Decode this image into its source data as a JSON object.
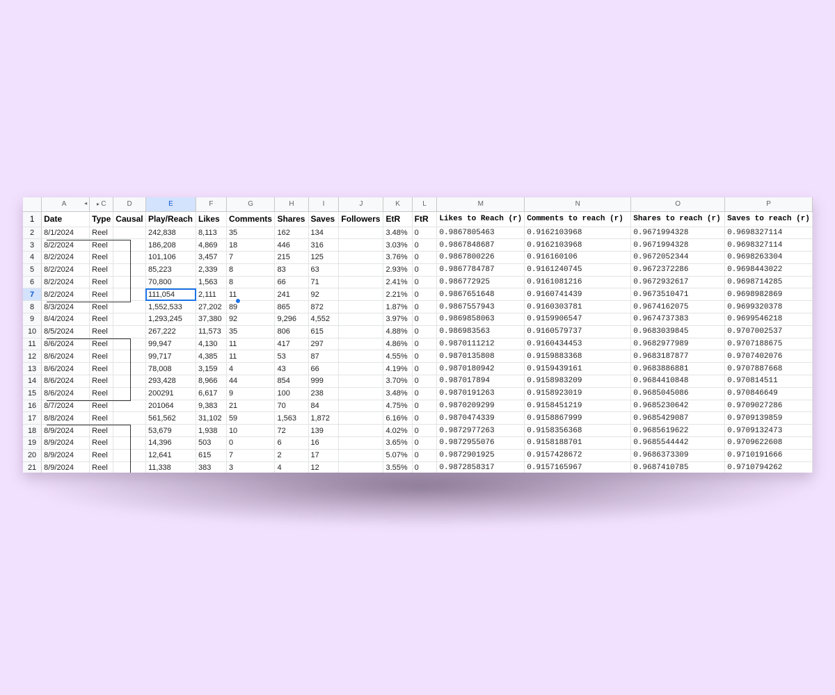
{
  "colors": {
    "background": "#f2e1fe",
    "selection": "#1a73e8",
    "selected_header_bg": "#d3e3fd"
  },
  "column_letters": [
    "A",
    "C",
    "D",
    "E",
    "F",
    "G",
    "H",
    "I",
    "J",
    "K",
    "L",
    "M",
    "N",
    "O",
    "P"
  ],
  "hidden_column_indicator": "◂ ▸",
  "headers": [
    "Date",
    "Type",
    "Causal",
    "Play/Reach",
    "Likes",
    "Comments",
    "Shares",
    "Saves",
    "Followers",
    "EtR",
    "FtR",
    "Likes to Reach (r)",
    "Comments to reach (r)",
    "Shares to reach (r)",
    "Saves to reach (r)"
  ],
  "header_row_number": "1",
  "active_cell": "E7",
  "rows": [
    {
      "n": "2",
      "cells": [
        "8/1/2024",
        "Reel",
        "",
        "242,838",
        "8,113",
        "35",
        "162",
        "134",
        "",
        "3.48%",
        "0",
        "0.9867805463",
        "0.9162103968",
        "0.9671994328",
        "0.9698327114"
      ]
    },
    {
      "n": "3",
      "cells": [
        "8/2/2024",
        "Reel",
        "",
        "186,208",
        "4,869",
        "18",
        "446",
        "316",
        "",
        "3.03%",
        "0",
        "0.9867848687",
        "0.9162103968",
        "0.9671994328",
        "0.9698327114"
      ]
    },
    {
      "n": "4",
      "cells": [
        "8/2/2024",
        "Reel",
        "",
        "101,106",
        "3,457",
        "7",
        "215",
        "125",
        "",
        "3.76%",
        "0",
        "0.9867800226",
        "0.916160106",
        "0.9672052344",
        "0.9698263304"
      ]
    },
    {
      "n": "5",
      "cells": [
        "8/2/2024",
        "Reel",
        "",
        "85,223",
        "2,339",
        "8",
        "83",
        "63",
        "",
        "2.93%",
        "0",
        "0.9867784787",
        "0.9161240745",
        "0.9672372286",
        "0.9698443022"
      ]
    },
    {
      "n": "6",
      "cells": [
        "8/2/2024",
        "Reel",
        "",
        "70,800",
        "1,563",
        "8",
        "66",
        "71",
        "",
        "2.41%",
        "0",
        "0.986772925",
        "0.9161081216",
        "0.9672932617",
        "0.9698714285"
      ]
    },
    {
      "n": "7",
      "cells": [
        "8/2/2024",
        "Reel",
        "",
        "111,054",
        "2,111",
        "11",
        "241",
        "92",
        "",
        "2.21%",
        "0",
        "0.9867651648",
        "0.9160741439",
        "0.9673510471",
        "0.9698982869"
      ]
    },
    {
      "n": "8",
      "cells": [
        "8/3/2024",
        "Reel",
        "",
        "1,552,533",
        "27,202",
        "89",
        "865",
        "872",
        "",
        "1.87%",
        "0",
        "0.9867557943",
        "0.9160303781",
        "0.9674162075",
        "0.9699320378"
      ]
    },
    {
      "n": "9",
      "cells": [
        "8/4/2024",
        "Reel",
        "",
        "1,293,245",
        "37,380",
        "92",
        "9,296",
        "4,552",
        "",
        "3.97%",
        "0",
        "0.9869858063",
        "0.9159906547",
        "0.9674737383",
        "0.9699546218"
      ]
    },
    {
      "n": "10",
      "cells": [
        "8/5/2024",
        "Reel",
        "",
        "267,222",
        "11,573",
        "35",
        "806",
        "615",
        "",
        "4.88%",
        "0",
        "0.986983563",
        "0.9160579737",
        "0.9683039845",
        "0.9707002537"
      ]
    },
    {
      "n": "11",
      "cells": [
        "8/6/2024",
        "Reel",
        "",
        "99,947",
        "4,130",
        "11",
        "417",
        "297",
        "",
        "4.86%",
        "0",
        "0.9870111212",
        "0.9160434453",
        "0.9682977989",
        "0.9707188675"
      ]
    },
    {
      "n": "12",
      "cells": [
        "8/6/2024",
        "Reel",
        "",
        "99,717",
        "4,385",
        "11",
        "53",
        "87",
        "",
        "4.55%",
        "0",
        "0.9870135808",
        "0.9159883368",
        "0.9683187877",
        "0.9707402076"
      ]
    },
    {
      "n": "13",
      "cells": [
        "8/6/2024",
        "Reel",
        "",
        "78,008",
        "3,159",
        "4",
        "43",
        "66",
        "",
        "4.19%",
        "0",
        "0.9870180942",
        "0.9159439161",
        "0.9683886881",
        "0.9707887668"
      ]
    },
    {
      "n": "14",
      "cells": [
        "8/6/2024",
        "Reel",
        "",
        "293,428",
        "8,966",
        "44",
        "854",
        "999",
        "",
        "3.70%",
        "0",
        "0.987017894",
        "0.9158983209",
        "0.9684410848",
        "0.970814511"
      ]
    },
    {
      "n": "15",
      "cells": [
        "8/6/2024",
        "Reel",
        "",
        "200291",
        "6,617",
        "9",
        "100",
        "238",
        "",
        "3.48%",
        "0",
        "0.9870191263",
        "0.9158923019",
        "0.9685045086",
        "0.970846649"
      ]
    },
    {
      "n": "16",
      "cells": [
        "8/7/2024",
        "Reel",
        "",
        "201064",
        "9,383",
        "21",
        "70",
        "84",
        "",
        "4.75%",
        "0",
        "0.9870209299",
        "0.9158451219",
        "0.9685230642",
        "0.9709027286"
      ]
    },
    {
      "n": "17",
      "cells": [
        "8/8/2024",
        "Reel",
        "",
        "561,562",
        "31,102",
        "59",
        "1,563",
        "1,872",
        "",
        "6.16%",
        "0",
        "0.9870474339",
        "0.9158867999",
        "0.9685429087",
        "0.9709139859"
      ]
    },
    {
      "n": "18",
      "cells": [
        "8/9/2024",
        "Reel",
        "",
        "53,679",
        "1,938",
        "10",
        "72",
        "139",
        "",
        "4.02%",
        "0",
        "0.9872977263",
        "0.9158356368",
        "0.9685619622",
        "0.9709132473"
      ]
    },
    {
      "n": "19",
      "cells": [
        "8/9/2024",
        "Reel",
        "",
        "14,396",
        "503",
        "0",
        "6",
        "16",
        "",
        "3.65%",
        "0",
        "0.9872955076",
        "0.9158188701",
        "0.9685544442",
        "0.9709622608"
      ]
    },
    {
      "n": "20",
      "cells": [
        "8/9/2024",
        "Reel",
        "",
        "12,641",
        "615",
        "7",
        "2",
        "17",
        "",
        "5.07%",
        "0",
        "0.9872901925",
        "0.9157428672",
        "0.9686373309",
        "0.9710191666"
      ]
    },
    {
      "n": "21",
      "cells": [
        "8/9/2024",
        "Reel",
        "",
        "11,338",
        "383",
        "3",
        "4",
        "12",
        "",
        "3.55%",
        "0",
        "0.9872858317",
        "0.9157165967",
        "0.9687410785",
        "0.9710794262"
      ]
    }
  ]
}
